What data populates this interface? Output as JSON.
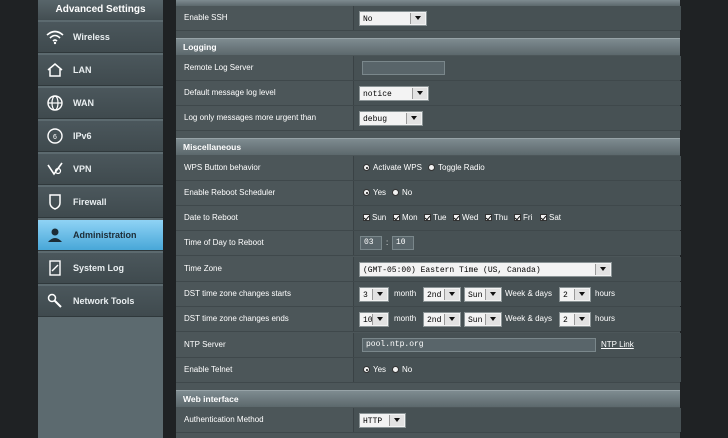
{
  "sidebar": {
    "title": "Advanced Settings",
    "items": [
      {
        "label": "Wireless",
        "icon": "wifi-icon"
      },
      {
        "label": "LAN",
        "icon": "home-icon"
      },
      {
        "label": "WAN",
        "icon": "globe-icon"
      },
      {
        "label": "IPv6",
        "icon": "ipv6-icon"
      },
      {
        "label": "VPN",
        "icon": "vpn-icon"
      },
      {
        "label": "Firewall",
        "icon": "shield-icon"
      },
      {
        "label": "Administration",
        "icon": "user-icon",
        "active": true
      },
      {
        "label": "System Log",
        "icon": "log-icon"
      },
      {
        "label": "Network Tools",
        "icon": "tools-icon"
      }
    ]
  },
  "main": {
    "ssh": {
      "label": "Enable SSH",
      "value": "No"
    },
    "logging": {
      "header": "Logging",
      "remote_log_server": {
        "label": "Remote Log Server",
        "value": ""
      },
      "default_level": {
        "label": "Default message log level",
        "value": "notice"
      },
      "urgent_level": {
        "label": "Log only messages more urgent than",
        "value": "debug"
      }
    },
    "misc": {
      "header": "Miscellaneous",
      "wps": {
        "label": "WPS Button behavior",
        "opt1": "Activate WPS",
        "opt2": "Toggle Radio"
      },
      "reboot_scheduler": {
        "label": "Enable Reboot Scheduler",
        "opt1": "Yes",
        "opt2": "No"
      },
      "date_to_reboot": {
        "label": "Date to Reboot",
        "days": [
          "Sun",
          "Mon",
          "Tue",
          "Wed",
          "Thu",
          "Fri",
          "Sat"
        ]
      },
      "time_to_reboot": {
        "label": "Time of Day to Reboot",
        "hour": "03",
        "sep": ":",
        "minute": "10"
      },
      "time_zone": {
        "label": "Time Zone",
        "value": "(GMT-05:00) Eastern Time (US, Canada)"
      },
      "dst_start": {
        "label": "DST time zone changes starts",
        "month": "3",
        "month_label": "month",
        "week": "2nd",
        "day": "Sun",
        "week_days_label": "Week & days",
        "hours": "2",
        "hours_label": "hours"
      },
      "dst_end": {
        "label": "DST time zone changes ends",
        "month": "10",
        "month_label": "month",
        "week": "2nd",
        "day": "Sun",
        "week_days_label": "Week & days",
        "hours": "2",
        "hours_label": "hours"
      },
      "ntp": {
        "label": "NTP Server",
        "value": "pool.ntp.org",
        "link": "NTP Link"
      },
      "telnet": {
        "label": "Enable Telnet",
        "opt1": "Yes",
        "opt2": "No"
      }
    },
    "web": {
      "header": "Web interface",
      "auth": {
        "label": "Authentication Method",
        "value": "HTTP"
      }
    }
  },
  "colors": {
    "active_menu": "#48a7d8",
    "panel": "#4c5659",
    "header": "#6e7b80"
  }
}
